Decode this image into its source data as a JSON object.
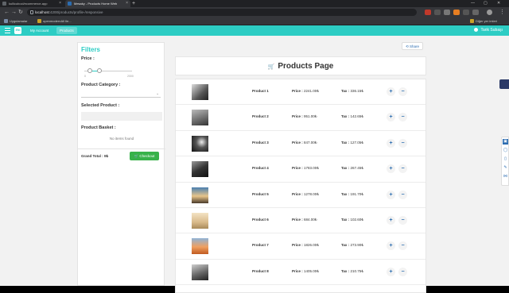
{
  "browser": {
    "tabs": [
      {
        "label": "kullicuboci/ecommerce-app"
      },
      {
        "label": "Mesaky - Products Home Web"
      }
    ],
    "new_tab": "+",
    "url_host": "localhost",
    "url_path": ":4200/products/profile-/responsive",
    "bookmarks": [
      {
        "label": "Uygulamalar"
      },
      {
        "label": "openmodernAll Ile..."
      }
    ],
    "other_bookmarks": "Diğer yer imleri",
    "window_controls": {
      "minimize": "—",
      "maximize": "▢",
      "close": "✕"
    }
  },
  "navbar": {
    "logo": "ENI",
    "links": [
      {
        "label": "My Account"
      },
      {
        "label": "Products"
      }
    ],
    "user_name": "Tarik Subaşı"
  },
  "sidebar": {
    "title": "Filters",
    "price_label": "Price :",
    "price_min": "0",
    "price_max": "2000",
    "category_label": "Product Category :",
    "selected_label": "Selected Product :",
    "basket_label": "Product Basket :",
    "basket_empty": "No items found",
    "grand_total": "Grand Total : 0₺",
    "checkout_label": "Checkout"
  },
  "main": {
    "share_label": "Share",
    "page_title": "Products Page",
    "price_prefix": "Price :",
    "tax_prefix": "Tax :",
    "plus": "+",
    "minus": "−",
    "products": [
      {
        "name": "Product 1",
        "price": "2241.00₺",
        "tax": "336.15₺"
      },
      {
        "name": "Product 2",
        "price": "951.00₺",
        "tax": "142.65₺"
      },
      {
        "name": "Product 3",
        "price": "847.00₺",
        "tax": "127.05₺"
      },
      {
        "name": "Product 4",
        "price": "1783.00₺",
        "tax": "267.45₺"
      },
      {
        "name": "Product 5",
        "price": "1278.00₺",
        "tax": "191.70₺"
      },
      {
        "name": "Product 6",
        "price": "684.00₺",
        "tax": "102.60₺"
      },
      {
        "name": "Product 7",
        "price": "1826.00₺",
        "tax": "273.90₺"
      },
      {
        "name": "Product 8",
        "price": "1405.00₺",
        "tax": "210.75₺"
      }
    ]
  },
  "colors": {
    "accent": "#2dcdc4",
    "checkout": "#38b24a",
    "link": "#2b6cb0"
  }
}
